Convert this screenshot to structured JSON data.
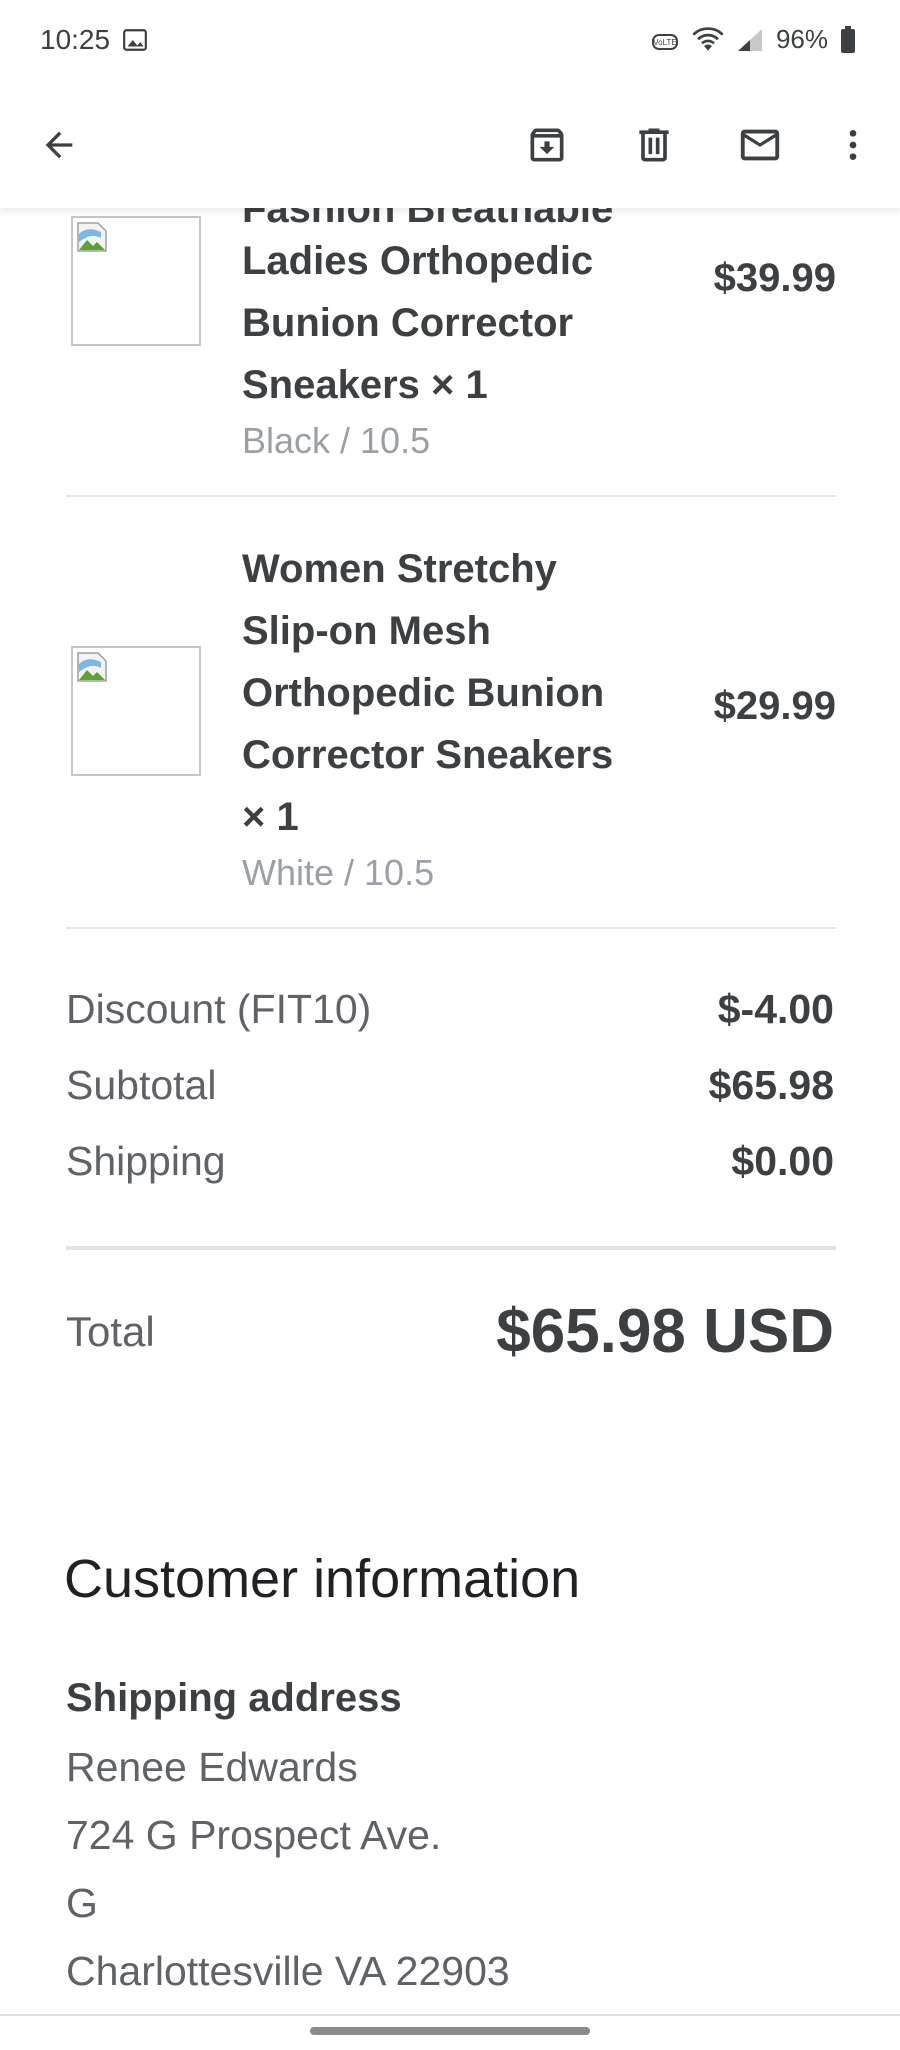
{
  "status_bar": {
    "time": "10:25",
    "battery": "96%",
    "icons": [
      "gallery-icon",
      "volte-icon",
      "wifi-icon",
      "signal-icon",
      "battery-icon"
    ]
  },
  "app_bar": {
    "icons": [
      "back-arrow-icon",
      "archive-icon",
      "delete-icon",
      "mark-unread-icon",
      "more-vert-icon"
    ]
  },
  "order": {
    "items": [
      {
        "title_partial": "Fashion Breathable",
        "title": "Ladies Orthopedic Bunion Corrector Sneakers × 1",
        "variant": "Black / 10.5",
        "price": "$39.99"
      },
      {
        "title": "Women Stretchy Slip-on Mesh Orthopedic Bunion Corrector Sneakers × 1",
        "variant": "White / 10.5",
        "price": "$29.99"
      }
    ],
    "summary": [
      {
        "label": "Discount (FIT10)",
        "value": "$-4.00"
      },
      {
        "label": "Subtotal",
        "value": "$65.98"
      },
      {
        "label": "Shipping",
        "value": "$0.00"
      }
    ],
    "total_label": "Total",
    "total_value": "$65.98 USD"
  },
  "customer": {
    "section_title": "Customer information",
    "shipping_heading": "Shipping address",
    "address_lines": [
      "Renee Edwards",
      "724 G Prospect Ave.",
      "G",
      "Charlottesville VA 22903"
    ]
  }
}
